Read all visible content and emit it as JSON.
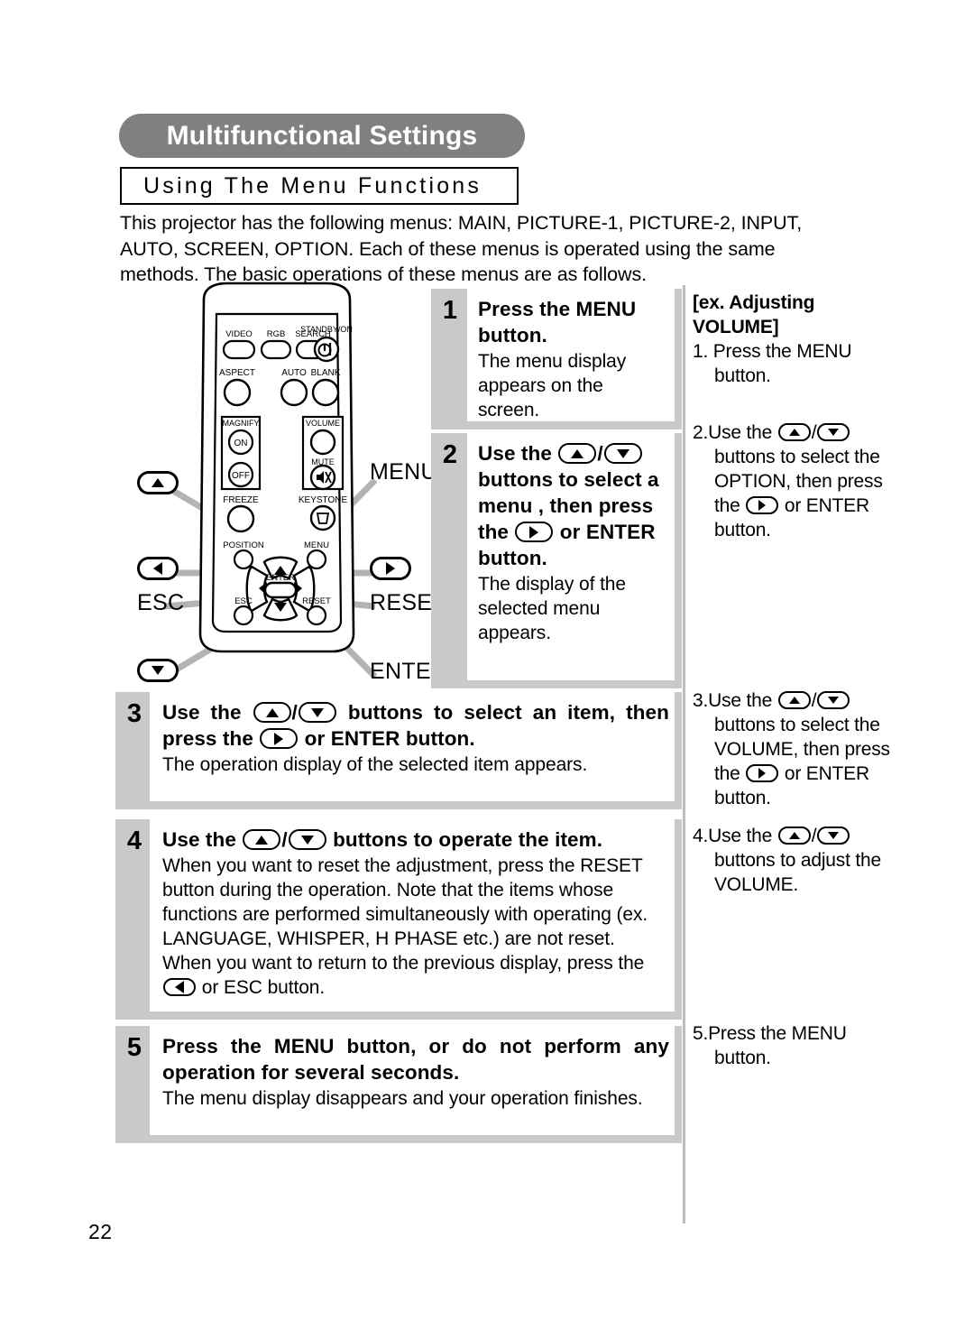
{
  "page": {
    "title": "Multifunctional Settings",
    "subtitle": "Using The Menu Functions",
    "intro": "This projector has the following menus: MAIN, PICTURE-1, PICTURE-2, INPUT, AUTO, SCREEN, OPTION. Each of these menus is operated using the same methods. The basic operations of these menus are as follows.",
    "page_number": "22"
  },
  "steps": [
    {
      "number": "1",
      "head_a": "Press the MENU",
      "head_b": "button.",
      "desc": "The menu display appears on the screen."
    },
    {
      "number": "2",
      "head_a": "Use the",
      "head_b": "buttons to select a menu , then press the",
      "head_c": "or ENTER button.",
      "desc": "The display of the selected menu appears."
    },
    {
      "number": "3",
      "head_a": "Use the",
      "head_b": "buttons to select an item, then press the",
      "head_c": "or ENTER button.",
      "desc": "The operation display of the selected item appears."
    },
    {
      "number": "4",
      "head_a": "Use the",
      "head_b": "buttons to operate the item.",
      "desc_a": "When you want to reset the adjustment, press the RESET button during the operation. Note that the items whose functions are performed simultaneously with operating (ex. LANGUAGE, WHISPER, H PHASE etc.) are not reset.",
      "desc_b": "When you want to return to the previous display, press the",
      "desc_c": "or ESC button."
    },
    {
      "number": "5",
      "head_a": "Press the MENU button, or do not perform any operation for several seconds.",
      "desc": "The menu display disappears and your operation finishes."
    }
  ],
  "example": {
    "heading": "[ex. Adjusting VOLUME]",
    "item1": "1. Press the MENU button.",
    "item2_a": "2.Use the",
    "item2_b": "buttons to select the OPTION, then press the",
    "item2_c": "or ENTER button.",
    "item3_a": "3.Use the",
    "item3_b": "buttons to select the VOLUME, then press the",
    "item3_c": "or ENTER button.",
    "item4_a": "4.Use the",
    "item4_b": "buttons to adjust the VOLUME.",
    "item5": "5.Press the MENU button."
  },
  "remote": {
    "buttons": {
      "video": "VIDEO",
      "rgb": "RGB",
      "search": "SEARCH",
      "standby_on": "STANDBY/ON",
      "aspect": "ASPECT",
      "auto": "AUTO",
      "blank": "BLANK",
      "magnify": "MAGNIFY",
      "magnify_on": "ON",
      "magnify_off": "OFF",
      "volume": "VOLUME",
      "mute": "MUTE",
      "freeze": "FREEZE",
      "keystone": "KEYSTONE",
      "position": "POSITION",
      "menu": "MENU",
      "enter": "ENTER",
      "esc": "ESC",
      "reset": "RESET"
    },
    "callouts": {
      "menu": "MENU",
      "esc": "ESC",
      "reset": "RESET",
      "enter": "ENTER"
    }
  },
  "colors": {
    "banner_gray": "#808080",
    "box_gray": "#c9c9c9",
    "divider_gray": "#bdbdbd"
  }
}
